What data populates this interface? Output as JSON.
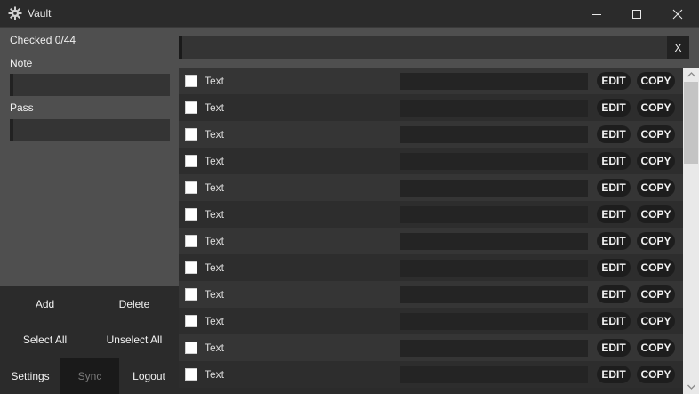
{
  "window": {
    "title": "Vault",
    "icon": "gear-icon"
  },
  "sidebar": {
    "checked_status": "Checked 0/44",
    "note_label": "Note",
    "note_value": "",
    "pass_label": "Pass",
    "pass_value": "",
    "buttons": {
      "add": "Add",
      "delete": "Delete",
      "select_all": "Select All",
      "unselect_all": "Unselect All",
      "settings": "Settings",
      "sync": "Sync",
      "logout": "Logout"
    }
  },
  "search": {
    "value": "",
    "clear_label": "X"
  },
  "list": {
    "edit_label": "EDIT",
    "copy_label": "COPY",
    "items": [
      {
        "text": "Text",
        "value": "",
        "checked": false
      },
      {
        "text": "Text",
        "value": "",
        "checked": false
      },
      {
        "text": "Text",
        "value": "",
        "checked": false
      },
      {
        "text": "Text",
        "value": "",
        "checked": false
      },
      {
        "text": "Text",
        "value": "",
        "checked": false
      },
      {
        "text": "Text",
        "value": "",
        "checked": false
      },
      {
        "text": "Text",
        "value": "",
        "checked": false
      },
      {
        "text": "Text",
        "value": "",
        "checked": false
      },
      {
        "text": "Text",
        "value": "",
        "checked": false
      },
      {
        "text": "Text",
        "value": "",
        "checked": false
      },
      {
        "text": "Text",
        "value": "",
        "checked": false
      },
      {
        "text": "Text",
        "value": "",
        "checked": false
      }
    ]
  },
  "colors": {
    "panel": "#4f4f4f",
    "background": "#2b2b2b",
    "row_even": "#353535",
    "row_odd": "#2d2d2d",
    "pill": "#1d1d1d"
  }
}
